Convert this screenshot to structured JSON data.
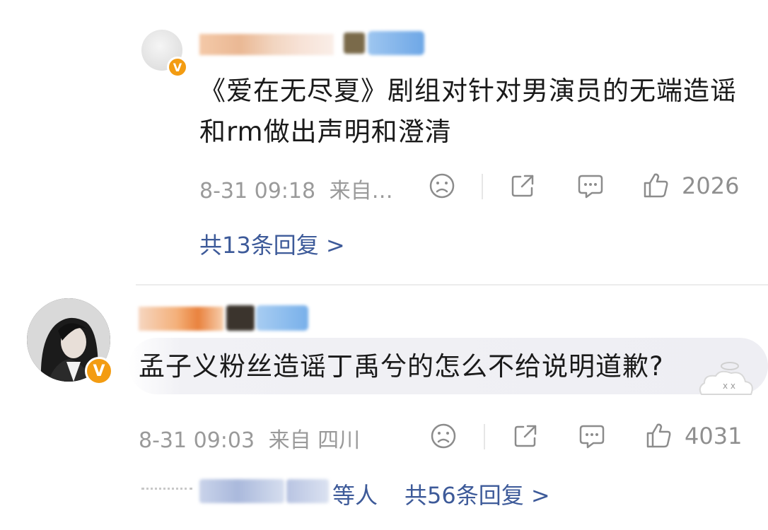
{
  "comment_1": {
    "text": "《爱在无尽夏》剧组对针对男演员的无端造谣和rm做出声明和澄清",
    "time": "8-31 09:18",
    "source": "来自…",
    "likes": "2026",
    "replies_label": "共13条回复 >",
    "icons": [
      "sad-face-icon",
      "share-icon",
      "comment-icon",
      "thumbs-up-icon"
    ]
  },
  "comment_2": {
    "text": "孟子义粉丝造谣丁禹兮的怎么不给说明道歉?",
    "time": "8-31 09:03",
    "source": "来自 四川",
    "likes": "4031",
    "replies_prefix": "等人",
    "replies_label": "共56条回复 >",
    "icons": [
      "sad-face-icon",
      "share-icon",
      "comment-icon",
      "thumbs-up-icon"
    ]
  },
  "colors": {
    "link": "#3d5a99",
    "meta": "#9a9a9a",
    "verified_badge": "#f39c12",
    "text": "#1a1a1a"
  }
}
